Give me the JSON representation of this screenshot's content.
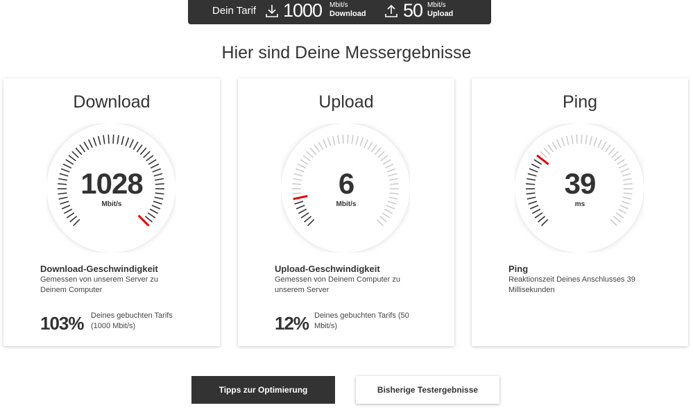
{
  "tarif": {
    "label": "Dein Tarif",
    "download_value": "1000",
    "download_unit": "Mbit/s",
    "download_label": "Download",
    "upload_value": "50",
    "upload_unit": "Mbit/s",
    "upload_label": "Upload"
  },
  "heading": "Hier sind Deine Messergebnisse",
  "cards": [
    {
      "title": "Download",
      "value": "1028",
      "unit": "Mbit/s",
      "gauge_level": 1.0,
      "desc_title": "Download-Geschwindigkeit",
      "desc_text": "Gemessen von unserem Server zu Deinem Computer",
      "pct": "103%",
      "pct_text": "Deines gebuchten Tarifs (1000 Mbit/s)"
    },
    {
      "title": "Upload",
      "value": "6",
      "unit": "Mbit/s",
      "gauge_level": 0.12,
      "desc_title": "Upload-Geschwindigkeit",
      "desc_text": "Gemessen von Deinem Computer zu unserem Server",
      "pct": "12%",
      "pct_text": "Deines gebuchten Tarifs (50 Mbit/s)"
    },
    {
      "title": "Ping",
      "value": "39",
      "unit": "ms",
      "gauge_level": 0.3,
      "desc_title": "Ping",
      "desc_text": "Reaktionszeit Deines Anschlusses 39 Millisekunden",
      "pct": "",
      "pct_text": ""
    }
  ],
  "buttons": {
    "tips": "Tipps zur Optimierung",
    "history": "Bisherige Testergebnisse"
  },
  "colors": {
    "accent": "#e60000",
    "dark": "#333333",
    "tick_active": "#333333",
    "tick_inactive": "#cccccc"
  }
}
